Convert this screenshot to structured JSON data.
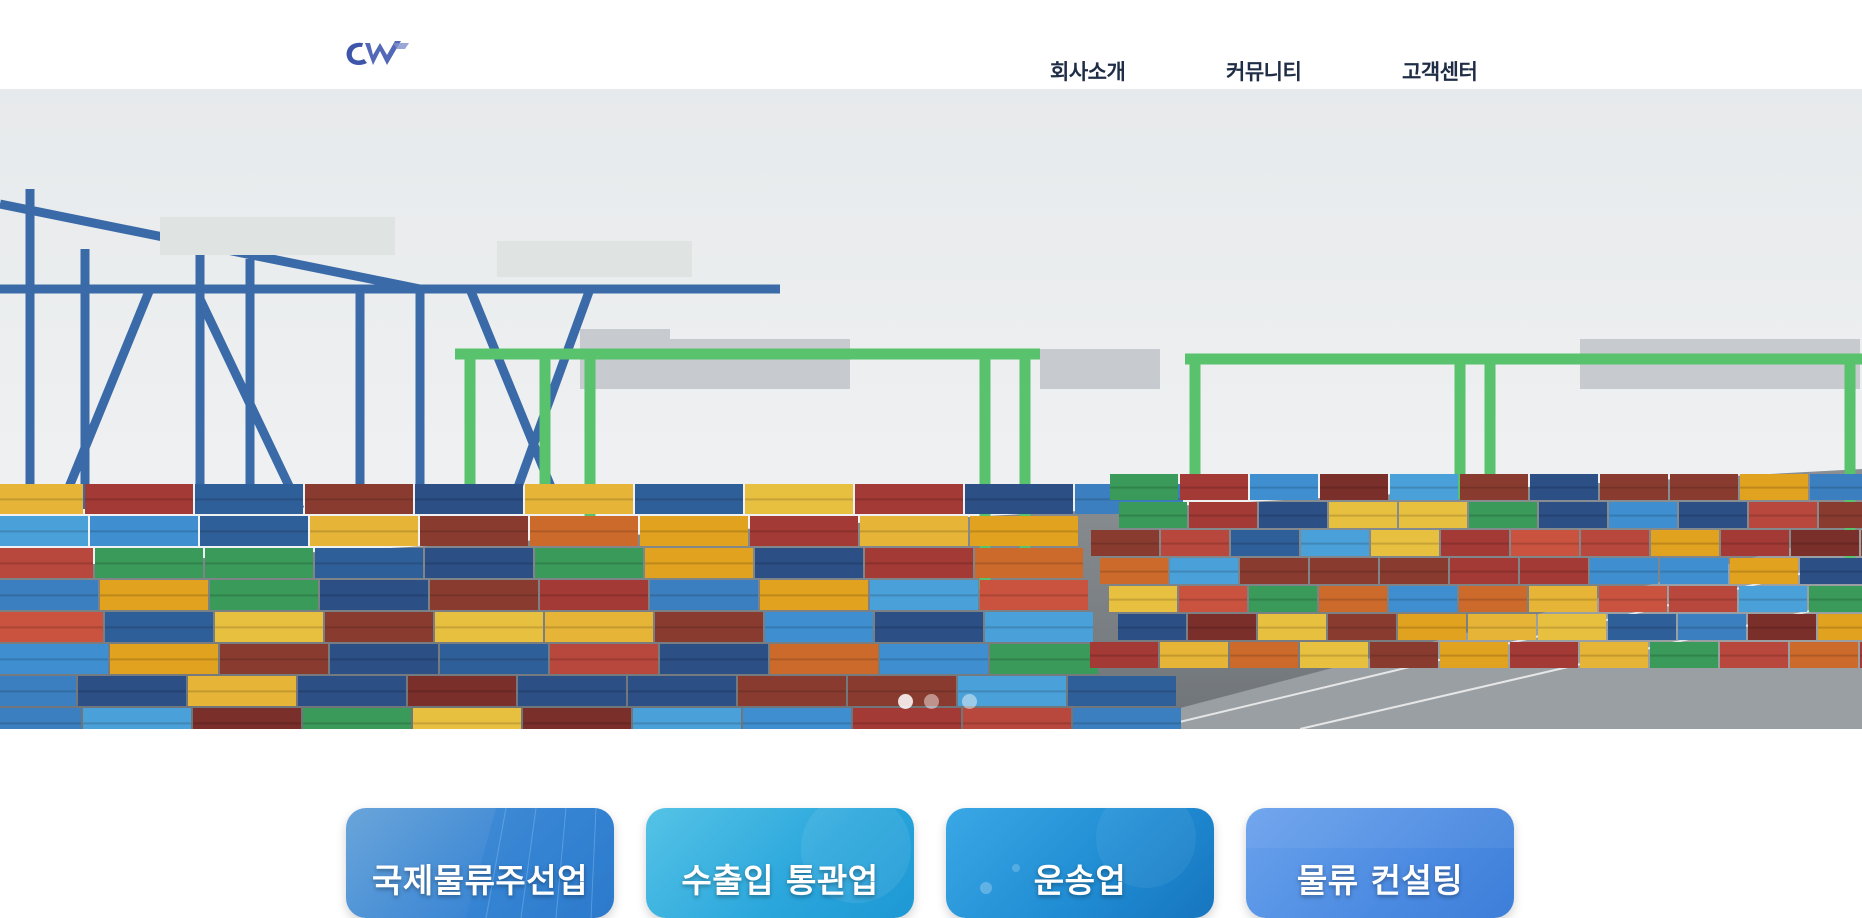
{
  "header": {
    "logo": {
      "icon": "company-logo-icon",
      "colors": [
        "#3b55a8",
        "#6f7fc4"
      ]
    },
    "nav": [
      {
        "label": "회사소개"
      },
      {
        "label": "커뮤니티"
      },
      {
        "label": "고객센터"
      }
    ],
    "text_color": "#1f2d46"
  },
  "hero": {
    "description_icon": "container-port-photo",
    "slides": 3,
    "active_slide": 1
  },
  "services": [
    {
      "label": "국제물류주선업",
      "color_from": "#4a8fd6",
      "color_to": "#2f7ad0"
    },
    {
      "label": "수출입 통관업",
      "color_from": "#3fb6e0",
      "color_to": "#1e9fd6"
    },
    {
      "label": "운송업",
      "color_from": "#2f9be0",
      "color_to": "#1b7fc7"
    },
    {
      "label": "물류 컨설팅",
      "color_from": "#5b9ae8",
      "color_to": "#3d7fdc"
    }
  ]
}
